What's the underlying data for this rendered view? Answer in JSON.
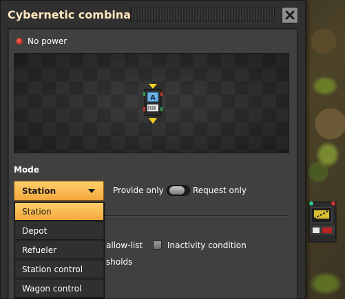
{
  "window": {
    "title": "Cybernetic combinator"
  },
  "status": {
    "text": "No power",
    "color": "#e0241a"
  },
  "mode": {
    "section_label": "Mode",
    "selected": "Station",
    "options": [
      "Station",
      "Depot",
      "Refueler",
      "Station control",
      "Wagon control"
    ]
  },
  "provide_request": {
    "left_label": "Provide only",
    "right_label": "Request only"
  },
  "options_row": {
    "allow_list_label": "allow-list",
    "inactivity_label": "Inactivity condition",
    "thresholds_label": "sholds"
  },
  "colors": {
    "accent": "#f4a83c",
    "window_bg": "#313031",
    "panel_bg": "#414041"
  },
  "icons": {
    "close": "close-icon",
    "combinator": "cybernetic-combinator-icon",
    "dropdown": "chevron-down-icon"
  }
}
